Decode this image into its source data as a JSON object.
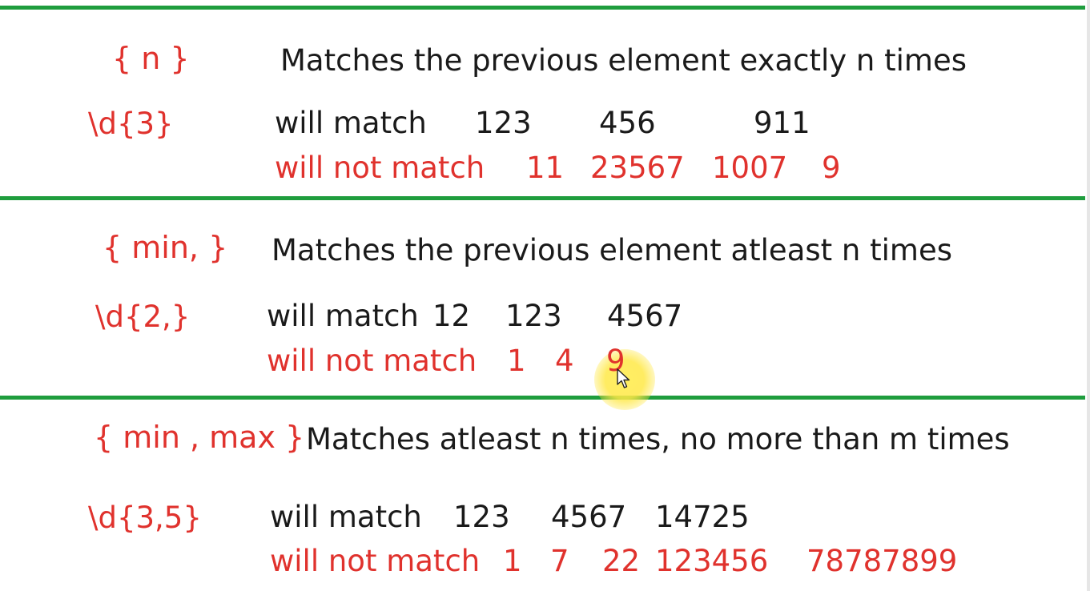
{
  "colors": {
    "accent_red": "#e0322d",
    "text_black": "#1a1a1a",
    "rule_green": "#1f9d3d",
    "cursor_highlight": "#ffe846"
  },
  "sections": [
    {
      "quantifier": "{ n }",
      "description": "Matches the previous element exactly n times",
      "example": "\\d{3}",
      "match_label": "will match",
      "match_values": [
        "123",
        "456",
        "911"
      ],
      "nomatch_label": "will not match",
      "nomatch_values": [
        "11",
        "23567",
        "1007",
        "9"
      ]
    },
    {
      "quantifier": "{ min, }",
      "description": "Matches the previous element atleast n times",
      "example": "\\d{2,}",
      "match_label": "will match",
      "match_values": [
        "12",
        "123",
        "4567"
      ],
      "nomatch_label": "will not match",
      "nomatch_values": [
        "1",
        "4",
        "9"
      ]
    },
    {
      "quantifier": "{ min , max }",
      "description": "Matches atleast n times, no more than m times",
      "example": "\\d{3,5}",
      "match_label": "will match",
      "match_values": [
        "123",
        "4567",
        "14725"
      ],
      "nomatch_label": "will not match",
      "nomatch_values": [
        "1",
        "7",
        "22",
        "123456",
        "78787899"
      ]
    }
  ],
  "cursor_icon": "mouse-pointer-icon"
}
